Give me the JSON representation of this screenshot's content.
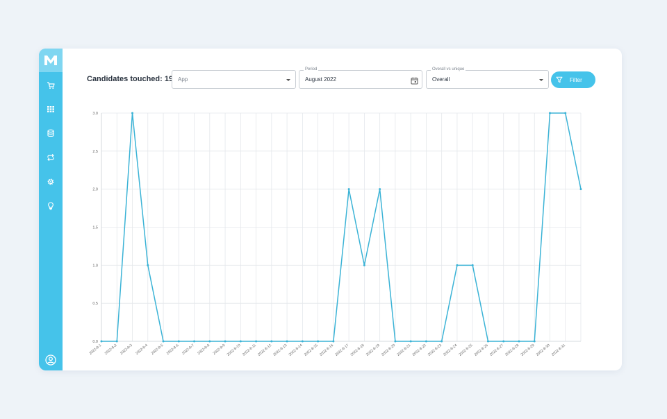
{
  "header": {
    "title": "Candidates touched: 19"
  },
  "filters": {
    "app": {
      "placeholder": "App"
    },
    "period": {
      "legend": "Period",
      "value": "August 2022"
    },
    "overall": {
      "legend": "Overall vs unique",
      "value": "Overall"
    },
    "filter_label": "Filter"
  },
  "sidebar": {
    "items": [
      {
        "icon": "cart-icon"
      },
      {
        "icon": "grid-icon"
      },
      {
        "icon": "database-icon"
      },
      {
        "icon": "repeat-icon"
      },
      {
        "icon": "settings-icon"
      },
      {
        "icon": "lightbulb-icon"
      }
    ],
    "profile_icon": "user-circle-icon"
  },
  "colors": {
    "accent": "#45c3ea",
    "logo_bg": "#7fd6f1",
    "line": "#3bb3d6"
  },
  "chart_data": {
    "type": "line",
    "title": "",
    "xlabel": "",
    "ylabel": "",
    "ylim": [
      0,
      3
    ],
    "yticks": [
      "0.0",
      "0.5",
      "1.0",
      "1.5",
      "2.0",
      "2.5",
      "3.0"
    ],
    "grid": true,
    "categories": [
      "2022-8-1",
      "2022-8-2",
      "2022-8-3",
      "2022-8-4",
      "2022-8-5",
      "2022-8-6",
      "2022-8-7",
      "2022-8-8",
      "2022-8-9",
      "2022-8-10",
      "2022-8-11",
      "2022-8-12",
      "2022-8-13",
      "2022-8-14",
      "2022-8-15",
      "2022-8-16",
      "2022-8-17",
      "2022-8-18",
      "2022-8-19",
      "2022-8-20",
      "2022-8-21",
      "2022-8-22",
      "2022-8-23",
      "2022-8-24",
      "2022-8-25",
      "2022-8-26",
      "2022-8-27",
      "2022-8-28",
      "2022-8-29",
      "2022-8-30",
      "2022-8-31"
    ],
    "series": [
      {
        "values": [
          0,
          0,
          3,
          1,
          0,
          0,
          0,
          0,
          0,
          0,
          0,
          0,
          0,
          0,
          0,
          0,
          2,
          1,
          2,
          0,
          0,
          0,
          0,
          1,
          1,
          0,
          0,
          0,
          0,
          3,
          3,
          2
        ]
      }
    ]
  }
}
